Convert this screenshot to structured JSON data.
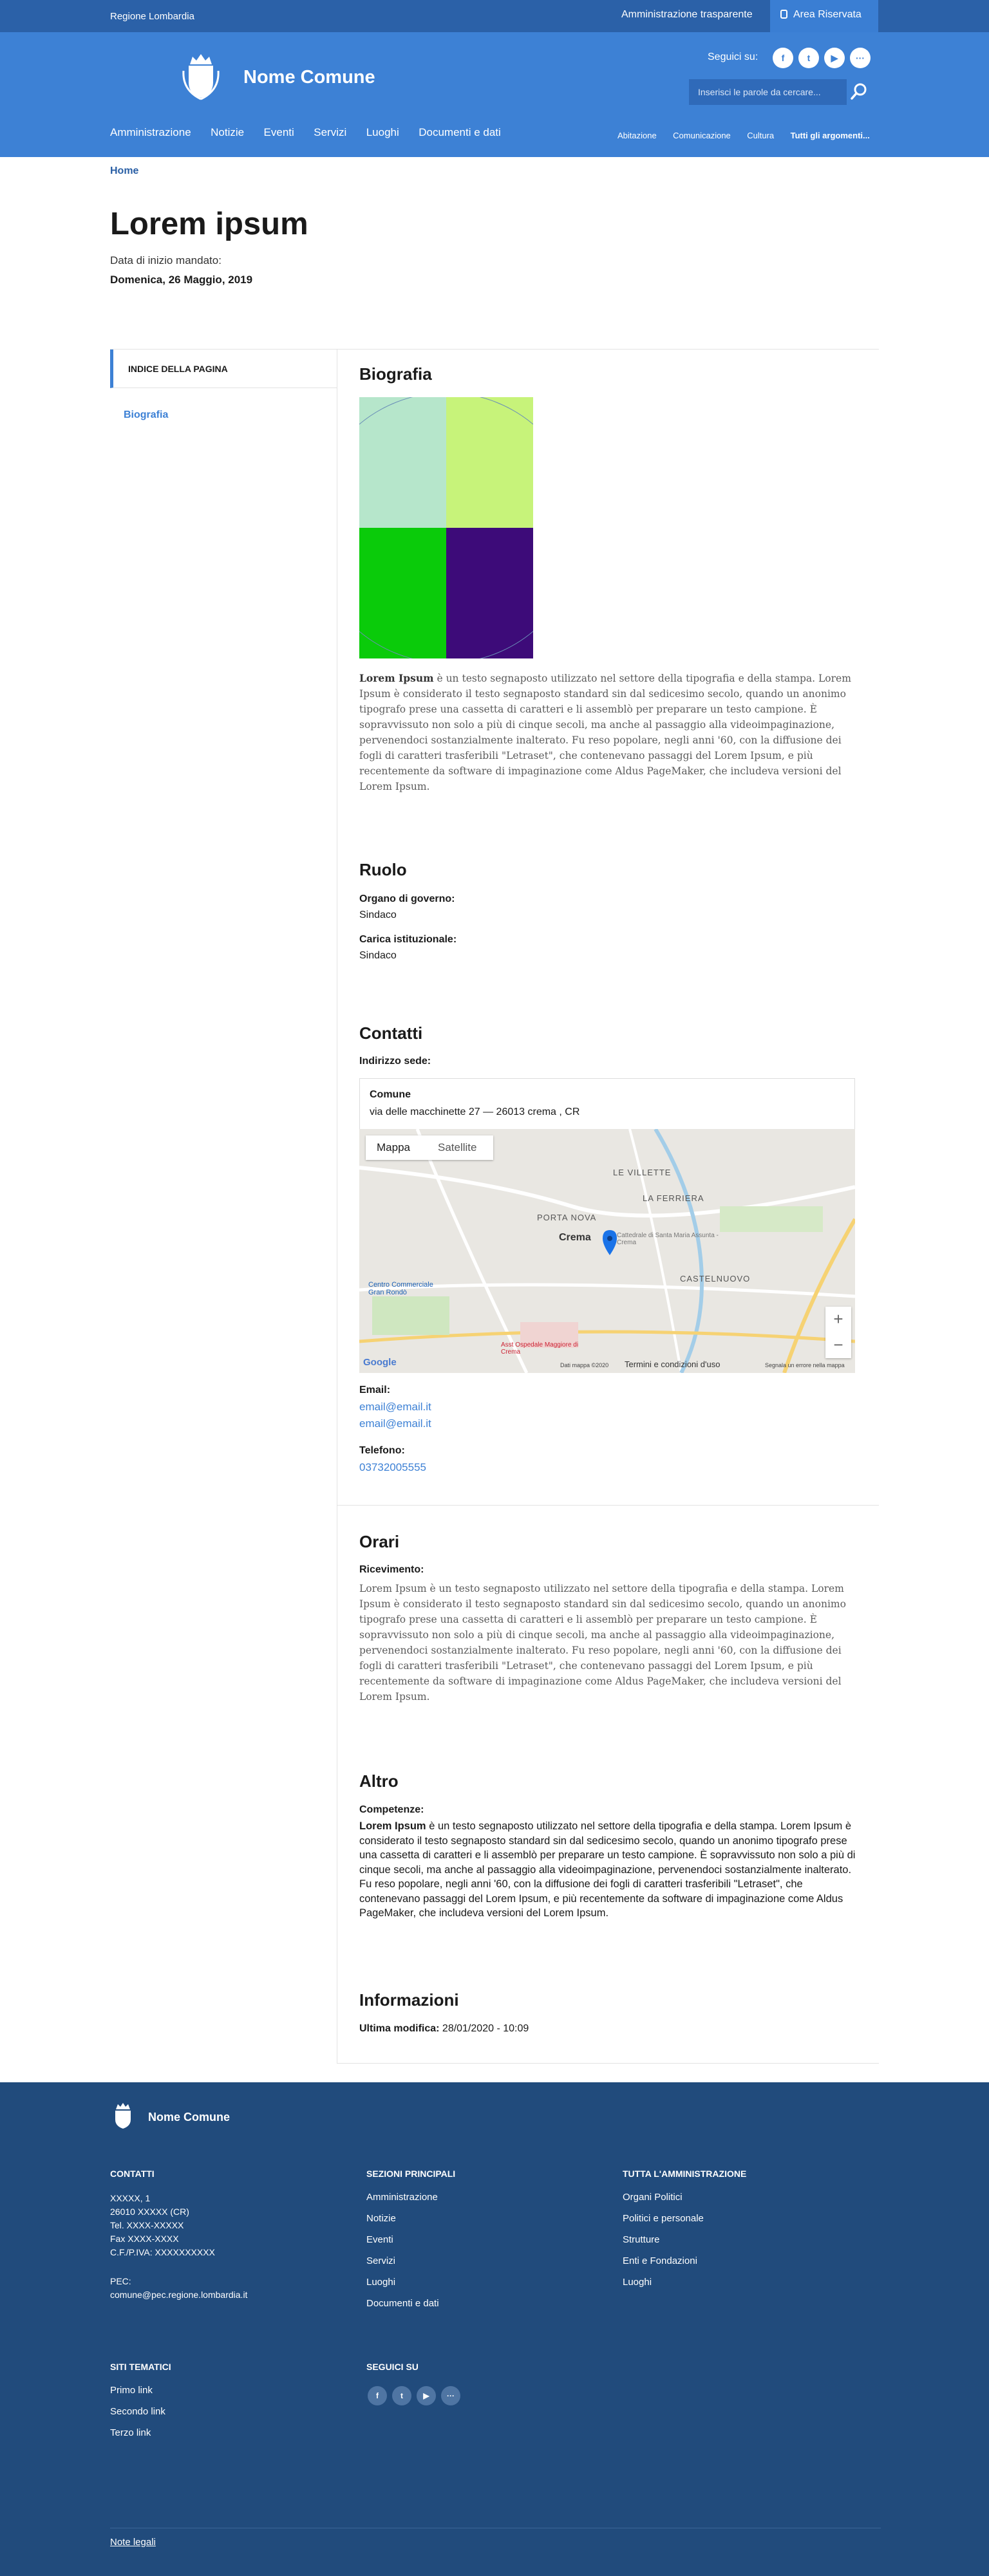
{
  "topbar": {
    "region": "Regione Lombardia",
    "transparent_admin": "Amministrazione trasparente",
    "reserved_area": "Area Riservata"
  },
  "header": {
    "brand": "Nome Comune",
    "follow_label": "Seguici su:",
    "social_icons": [
      "facebook-icon",
      "twitter-icon",
      "youtube-icon",
      "more-icon"
    ],
    "search_placeholder": "Inserisci le parole da cercare...",
    "main_nav": [
      "Amministrazione",
      "Notizie",
      "Eventi",
      "Servizi",
      "Luoghi",
      "Documenti e dati"
    ],
    "sub_nav": [
      "Abitazione",
      "Comunicazione",
      "Cultura",
      "Tutti gli argomenti..."
    ]
  },
  "breadcrumb": "Home",
  "page": {
    "title": "Lorem ipsum",
    "mandate_label": "Data di inizio mandato:",
    "mandate_value": "Domenica, 26 Maggio, 2019"
  },
  "sidebar": {
    "index_title": "INDICE DELLA PAGINA",
    "links": [
      "Biografia"
    ]
  },
  "biografia": {
    "heading": "Biografia",
    "image_colors": [
      "#b6e6cb",
      "#c7f37a",
      "#0acb0a",
      "#3d0b79"
    ],
    "text_bold": "Lorem Ipsum",
    "text": " è un testo segnaposto utilizzato nel settore della tipografia e della stampa. Lorem Ipsum è considerato il testo segnaposto standard sin dal sedicesimo secolo, quando un anonimo tipografo prese una cassetta di caratteri e li assemblò per preparare un testo campione. È sopravvissuto non solo a più di cinque secoli, ma anche al passaggio alla videoimpaginazione, pervenendoci sostanzialmente inalterato. Fu reso popolare, negli anni '60, con la diffusione dei fogli di caratteri trasferibili \"Letraset\", che contenevano passaggi del Lorem Ipsum, e più recentemente da software di impaginazione come Aldus PageMaker, che includeva versioni del Lorem Ipsum."
  },
  "ruolo": {
    "heading": "Ruolo",
    "organo_label": "Organo di governo:",
    "organo_value": "Sindaco",
    "carica_label": "Carica istituzionale:",
    "carica_value": "Sindaco"
  },
  "contatti": {
    "heading": "Contatti",
    "sede_label": "Indirizzo sede:",
    "place_name": "Comune",
    "place_address": "via delle macchinette 27 — 26013 crema , CR",
    "map": {
      "tab_map": "Mappa",
      "tab_satellite": "Satellite",
      "labels": [
        "LE VILLETTE",
        "LA FERRIERA",
        "PORTA NOVA",
        "Crema",
        "CASTELNUOVO",
        "Centro Commerciale Gran Rondò",
        "Cattedrale di Santa Maria Assunta - Crema",
        "Asst Ospedale Maggiore di Crema",
        "Google",
        "Dati mappa ©2020",
        "Termini e condizioni d'uso",
        "Segnala un errore nella mappa"
      ],
      "zoom_in": "+",
      "zoom_out": "−"
    },
    "email_label": "Email:",
    "emails": [
      "email@email.it",
      "email@email.it"
    ],
    "phone_label": "Telefono:",
    "phone": "03732005555"
  },
  "orari": {
    "heading": "Orari",
    "label": "Ricevimento:",
    "text": "Lorem Ipsum è un testo segnaposto utilizzato nel settore della tipografia e della stampa. Lorem Ipsum è considerato il testo segnaposto standard sin dal sedicesimo secolo, quando un anonimo tipografo prese una cassetta di caratteri e li assemblò per preparare un testo campione. È sopravvissuto non solo a più di cinque secoli, ma anche al passaggio alla videoimpaginazione, pervenendoci sostanzialmente inalterato. Fu reso popolare, negli anni '60, con la diffusione dei fogli di caratteri trasferibili \"Letraset\", che contenevano passaggi del Lorem Ipsum, e più recentemente da software di impaginazione come Aldus PageMaker, che includeva versioni del Lorem Ipsum."
  },
  "altro": {
    "heading": "Altro",
    "label": "Competenze:",
    "text_bold": "Lorem Ipsum",
    "text": " è un testo segnaposto utilizzato nel settore della tipografia e della stampa. Lorem Ipsum è considerato il testo segnaposto standard sin dal sedicesimo secolo, quando un anonimo tipografo prese una cassetta di caratteri e li assemblò per preparare un testo campione. È sopravvissuto non solo a più di cinque secoli, ma anche al passaggio alla videoimpaginazione, pervenendoci sostanzialmente inalterato. Fu reso popolare, negli anni '60, con la diffusione dei fogli di caratteri trasferibili \"Letraset\", che contenevano passaggi del Lorem Ipsum, e più recentemente da software di impaginazione come Aldus PageMaker, che includeva versioni del Lorem Ipsum."
  },
  "informazioni": {
    "heading": "Informazioni",
    "modified_label": "Ultima modifica:",
    "modified_value": " 28/01/2020 - 10:09"
  },
  "footer": {
    "brand": "Nome Comune",
    "contatti": {
      "heading": "CONTATTI",
      "lines": [
        "XXXXX, 1",
        "26010 XXXXX (CR)",
        "Tel. XXXX-XXXXX",
        "Fax XXXX-XXXX",
        "C.F./P.IVA: XXXXXXXXXX"
      ],
      "pec_label": "PEC:",
      "pec": "comune@pec.regione.lombardia.it"
    },
    "sezioni": {
      "heading": "SEZIONI PRINCIPALI",
      "links": [
        "Amministrazione",
        "Notizie",
        "Eventi",
        "Servizi",
        "Luoghi",
        "Documenti e dati"
      ]
    },
    "amministrazione": {
      "heading": "TUTTA L'AMMINISTRAZIONE",
      "links": [
        "Organi Politici",
        "Politici e personale",
        "Strutture",
        "Enti e Fondazioni",
        "Luoghi"
      ]
    },
    "siti": {
      "heading": "SITI TEMATICI",
      "links": [
        "Primo link",
        "Secondo link",
        "Terzo link"
      ]
    },
    "seguici": {
      "heading": "SEGUICI SU",
      "icons": [
        "facebook-icon",
        "twitter-icon",
        "youtube-icon",
        "more-icon"
      ]
    },
    "legal": "Note legali"
  },
  "colors": {
    "topbar": "#2b61a8",
    "header": "#3d81d5",
    "accent": "#3d81d5",
    "footer": "#214b7c"
  }
}
